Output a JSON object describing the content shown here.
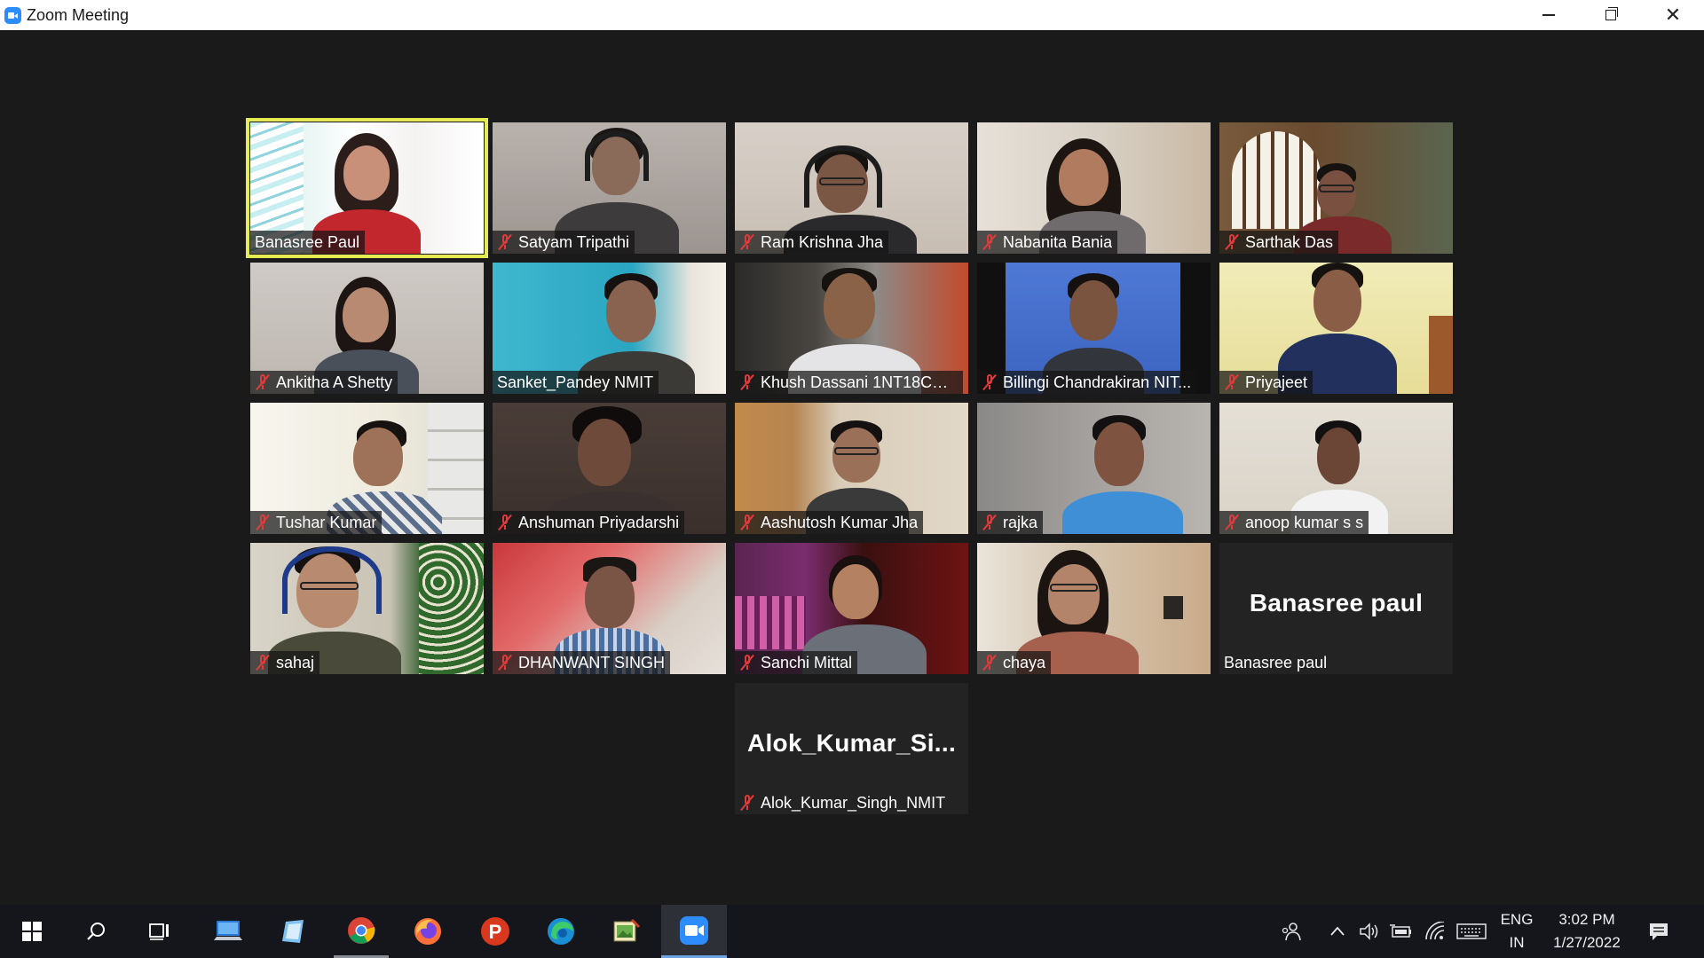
{
  "window": {
    "title": "Zoom Meeting"
  },
  "participants": [
    {
      "name": "Banasree Paul",
      "muted": false,
      "active": true
    },
    {
      "name": "Satyam Tripathi",
      "muted": true
    },
    {
      "name": "Ram Krishna Jha",
      "muted": true
    },
    {
      "name": "Nabanita Bania",
      "muted": true
    },
    {
      "name": "Sarthak Das",
      "muted": true
    },
    {
      "name": "Ankitha A Shetty",
      "muted": true
    },
    {
      "name": "Sanket_Pandey NMIT",
      "muted": false
    },
    {
      "name": "Khush Dassani 1NT18CS0...",
      "muted": true
    },
    {
      "name": "Billingi Chandrakiran NIT...",
      "muted": true
    },
    {
      "name": "Priyajeet",
      "muted": true
    },
    {
      "name": "Tushar Kumar",
      "muted": true
    },
    {
      "name": "Anshuman Priyadarshi",
      "muted": true
    },
    {
      "name": "Aashutosh Kumar Jha",
      "muted": true
    },
    {
      "name": "rajka",
      "muted": true
    },
    {
      "name": "anoop kumar s s",
      "muted": true
    },
    {
      "name": "sahaj",
      "muted": true
    },
    {
      "name": "DHANWANT SINGH",
      "muted": true
    },
    {
      "name": "Sanchi Mittal",
      "muted": true
    },
    {
      "name": "chaya",
      "muted": true
    },
    {
      "name": "Banasree paul",
      "muted": false,
      "video_off": true,
      "display_name": "Banasree paul"
    },
    {
      "name": "Alok_Kumar_Singh_NMIT",
      "muted": true,
      "video_off": true,
      "display_name": "Alok_Kumar_Si..."
    }
  ],
  "taskbar": {
    "apps": [
      {
        "icon": "start-windows-icon"
      },
      {
        "icon": "search-icon"
      },
      {
        "icon": "task-view-icon"
      },
      {
        "icon": "this-pc-icon"
      },
      {
        "icon": "notes-app-icon"
      },
      {
        "icon": "chrome-icon"
      },
      {
        "icon": "firefox-icon"
      },
      {
        "icon": "psiphon-icon"
      },
      {
        "icon": "edge-icon"
      },
      {
        "icon": "image-viewer-icon"
      },
      {
        "icon": "zoom-icon"
      }
    ],
    "language_top": "ENG",
    "language_bottom": "IN",
    "time": "3:02 PM",
    "date": "1/27/2022"
  },
  "colors": {
    "active_speaker_outline": "#e5ea55",
    "muted_mic": "#e03a3a",
    "zoom_blue": "#2d8cff",
    "meeting_background": "#1a1a1a"
  }
}
